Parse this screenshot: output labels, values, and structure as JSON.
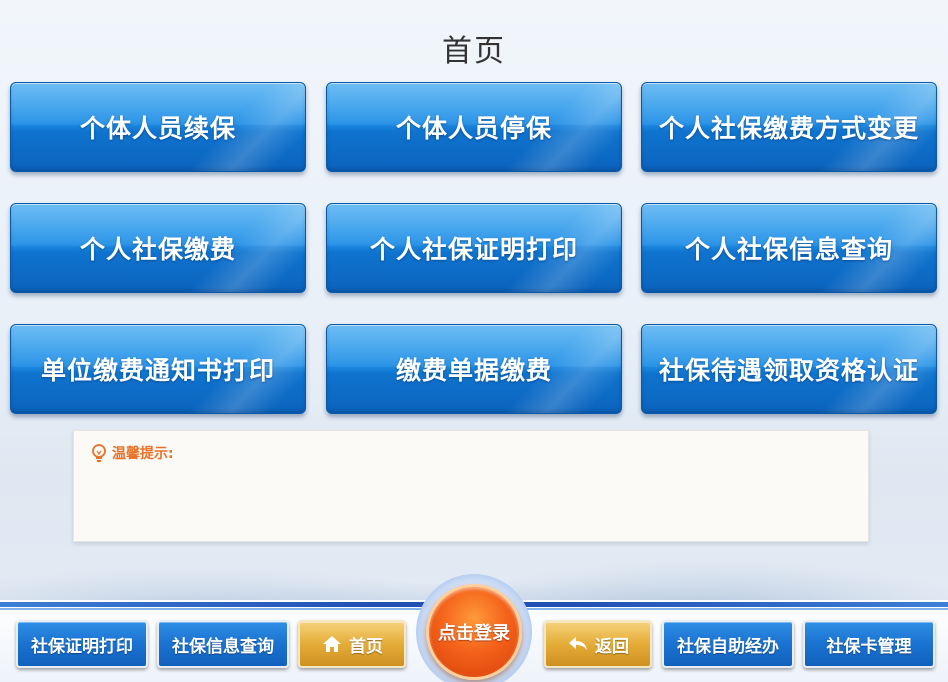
{
  "header": {
    "title": "首页"
  },
  "tiles": [
    {
      "label": "个体人员续保"
    },
    {
      "label": "个体人员停保"
    },
    {
      "label": "个人社保缴费方式变更"
    },
    {
      "label": "个人社保缴费"
    },
    {
      "label": "个人社保证明打印"
    },
    {
      "label": "个人社保信息查询"
    },
    {
      "label": "单位缴费通知书打印"
    },
    {
      "label": "缴费单据缴费"
    },
    {
      "label": "社保待遇领取资格认证"
    }
  ],
  "notice": {
    "label": "温馨提示:",
    "icon": "lightbulb-icon",
    "color": "#e8722a"
  },
  "bottom_nav": {
    "cert_print": "社保证明打印",
    "info_query": "社保信息查询",
    "home": "首页",
    "login": "点击登录",
    "back": "返回",
    "self_service": "社保自助经办",
    "card_manage": "社保卡管理"
  },
  "colors": {
    "tile_blue": "#1f8ee6",
    "gold": "#e4ad38",
    "login_orange": "#f4621a"
  }
}
